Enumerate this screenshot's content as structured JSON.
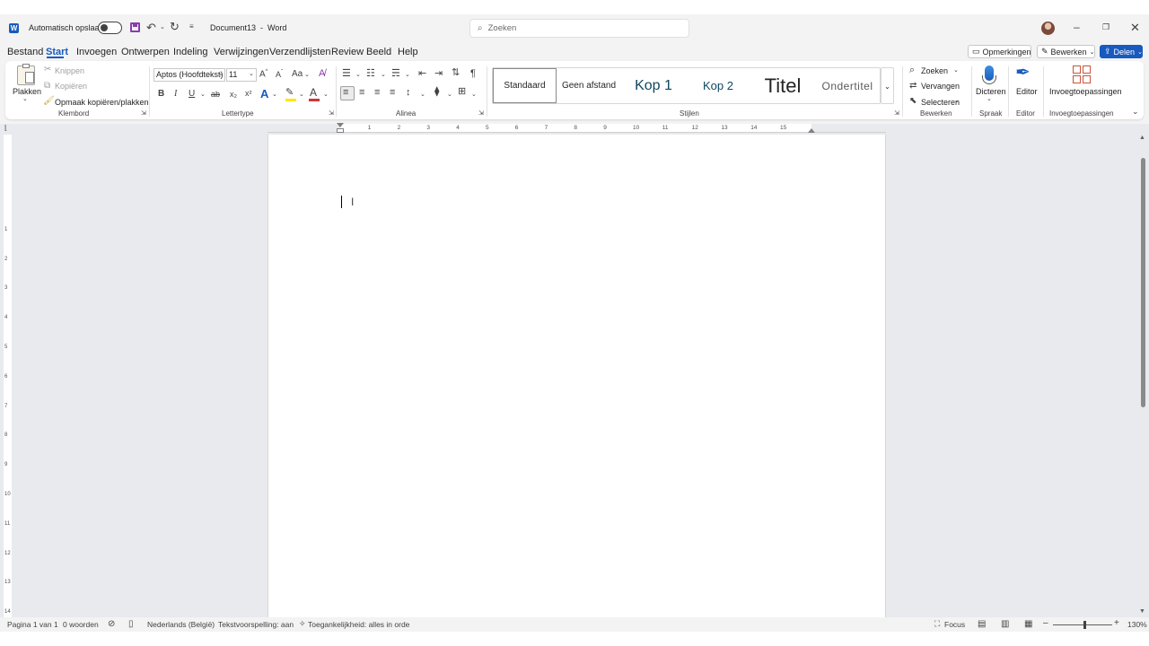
{
  "titlebar": {
    "autosave_label": "Automatisch opslaan",
    "doc_title": "Document13  -  Word",
    "search_placeholder": "Zoeken"
  },
  "menu": {
    "items": [
      "Bestand",
      "Start",
      "Invoegen",
      "Ontwerpen",
      "Indeling",
      "Verwijzingen",
      "Verzendlijsten",
      "Review",
      "Beeld",
      "Help"
    ],
    "active": "Start"
  },
  "top_buttons": {
    "comments": "Opmerkingen",
    "edit": "Bewerken",
    "share": "Delen"
  },
  "ribbon": {
    "clipboard": {
      "paste": "Plakken",
      "cut": "Knippen",
      "copy": "Kopiëren",
      "format_painter": "Opmaak kopiëren/plakken",
      "label": "Klembord"
    },
    "font": {
      "font_name": "Aptos (Hoofdtekst)",
      "font_size": "11",
      "bold": "B",
      "italic": "I",
      "underline": "U",
      "strike": "ab",
      "subscript": "x₂",
      "superscript": "x²",
      "case": "Aa",
      "label": "Lettertype"
    },
    "paragraph": {
      "pilcrow": "¶",
      "label": "Alinea"
    },
    "styles": {
      "items": [
        "Standaard",
        "Geen afstand",
        "Kop 1",
        "Kop 2",
        "Titel",
        "Ondertitel"
      ],
      "label": "Stijlen"
    },
    "editing": {
      "find": "Zoeken",
      "replace": "Vervangen",
      "select": "Selecteren",
      "label": "Bewerken"
    },
    "voice": {
      "dictate": "Dicteren",
      "label": "Spraak"
    },
    "editor": {
      "editor": "Editor",
      "label": "Editor"
    },
    "addins": {
      "addins": "Invoegtoepassingen",
      "label": "Invoegtoepassingen"
    }
  },
  "ruler": {
    "numbers": [
      "1",
      "2",
      "3",
      "4",
      "5",
      "6",
      "7",
      "8",
      "9",
      "10",
      "11",
      "12",
      "13",
      "14",
      "15"
    ],
    "vertical_numbers": [
      "1",
      "2",
      "3",
      "4",
      "5",
      "6",
      "7",
      "8",
      "9",
      "10",
      "11",
      "12",
      "13",
      "14"
    ]
  },
  "status": {
    "page": "Pagina 1 van 1",
    "words": "0 woorden",
    "language": "Nederlands (België)",
    "predictions": "Tekstvoorspelling: aan",
    "accessibility": "Toegankelijkheid: alles in orde",
    "focus": "Focus",
    "zoom": "130%"
  },
  "colors": {
    "accent": "#185abd",
    "chrome": "#f3f3f3",
    "doc_background": "#e8eaee",
    "save_icon": "#8b3ca8",
    "highlight_yellow": "#ffe600",
    "font_red": "#d13438"
  }
}
